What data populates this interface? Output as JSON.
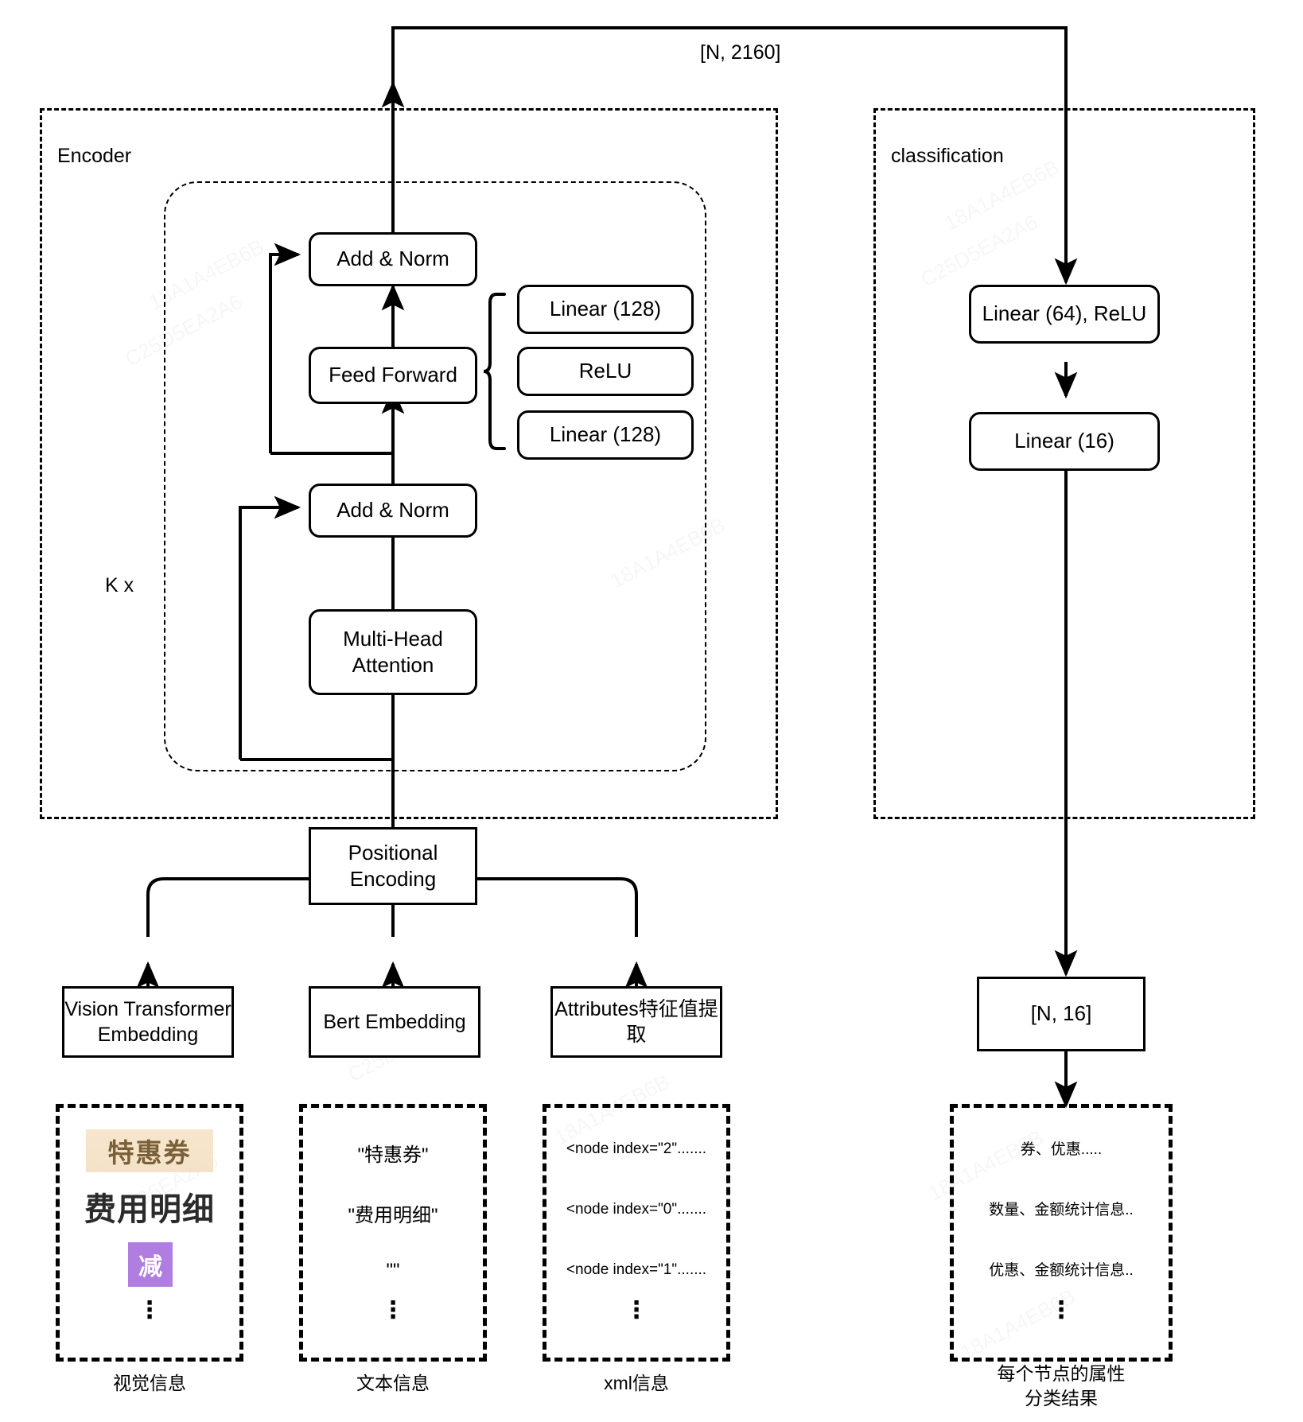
{
  "diagram": {
    "top_tensor_label": "[N, 2160]",
    "encoder_group_label": "Encoder",
    "classification_group_label": "classification",
    "repeat_label": "K x"
  },
  "encoder": {
    "blocks": {
      "add_norm_top": "Add & Norm",
      "feed_forward": "Feed Forward",
      "add_norm_bottom": "Add & Norm",
      "multi_head_attention": "Multi-Head\nAttention",
      "positional_encoding": "Positional\nEncoding"
    },
    "ffn_detail": [
      "Linear (128)",
      "ReLU",
      "Linear (128)"
    ]
  },
  "classification": {
    "blocks": [
      "Linear (64), ReLU",
      "Linear (16)"
    ],
    "output_tensor": "[N, 16]",
    "caption": "每个节点的属性\n分类结果",
    "samples": [
      "券、优惠.....",
      "数量、金额统计信息..",
      "优惠、金额统计信息..",
      "⋮"
    ]
  },
  "inputs": [
    {
      "embedding_label": "Vision Transformer\nEmbedding",
      "caption": "视觉信息",
      "kind": "visual",
      "chips": [
        {
          "text": "特惠券",
          "style": "coupon"
        },
        {
          "text": "费用明细",
          "style": "title"
        },
        {
          "text": "减",
          "style": "purple"
        }
      ],
      "ellipsis": "⋮"
    },
    {
      "embedding_label": "Bert Embedding",
      "caption": "文本信息",
      "kind": "text",
      "samples": [
        "\"特惠券\"",
        "\"费用明细\"",
        "\"\""
      ],
      "ellipsis": "⋮"
    },
    {
      "embedding_label": "Attributes特征值提\n取",
      "caption": "xml信息",
      "kind": "xml",
      "samples": [
        "<node index=\"2\".......",
        "<node index=\"0\".......",
        "<node index=\"1\"......."
      ],
      "ellipsis": "⋮"
    }
  ],
  "colors": {
    "stroke": "#000000",
    "background": "#ffffff",
    "coupon_bg": "#f5e3ca",
    "coupon_fg": "#7a6038",
    "purple_bg": "#b07ee0",
    "purple_fg": "#ffffff"
  }
}
